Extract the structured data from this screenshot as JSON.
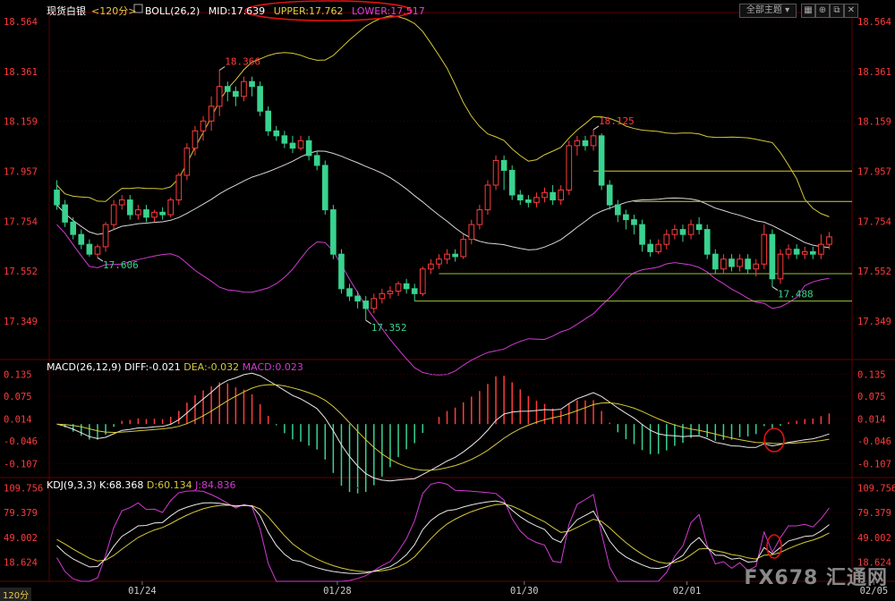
{
  "header": {
    "symbol": "现货白银",
    "period": "<120分>",
    "indicator": "BOLL(26,2)",
    "mid": "MID:17.639",
    "upper": "UPPER:17.762",
    "lower": "LOWER:17.517",
    "menu_label": "全部主题",
    "period_tag": "120分"
  },
  "colors": {
    "background": "#000000",
    "up_candle": "#ff3b3b",
    "down_candle": "#39d38f",
    "boll_mid": "#d8d8d8",
    "boll_upper": "#d6c93a",
    "boll_lower": "#d23bd2",
    "support_line": "#9bc33c",
    "annotation_circle": "#e01010"
  },
  "chart_data": [
    {
      "panel": "price",
      "type": "candlestick",
      "y_ticks": [
        "18.564",
        "18.361",
        "18.159",
        "17.957",
        "17.754",
        "17.552",
        "17.349"
      ],
      "ylim": [
        17.2,
        18.6
      ],
      "x_ticks": [
        "01/24",
        "01/28",
        "01/30",
        "02/01",
        "02/05"
      ],
      "annotations": [
        {
          "text": "18.366",
          "value": 18.366,
          "color": "#ff3b3b"
        },
        {
          "text": "17.606",
          "value": 17.606,
          "color": "#39d38f"
        },
        {
          "text": "17.352",
          "value": 17.352,
          "color": "#39d38f"
        },
        {
          "text": "18.125",
          "value": 18.125,
          "color": "#ff3b3b"
        },
        {
          "text": "17.488",
          "value": 17.488,
          "color": "#39d38f"
        }
      ],
      "horizontal_lines": [
        17.957,
        17.834,
        17.541,
        17.43
      ],
      "candles": [
        [
          17.88,
          17.82,
          17.92,
          17.8
        ],
        [
          17.82,
          17.75,
          17.84,
          17.73
        ],
        [
          17.75,
          17.7,
          17.77,
          17.68
        ],
        [
          17.7,
          17.66,
          17.72,
          17.64
        ],
        [
          17.66,
          17.62,
          17.68,
          17.61
        ],
        [
          17.62,
          17.65,
          17.66,
          17.606
        ],
        [
          17.65,
          17.74,
          17.75,
          17.63
        ],
        [
          17.74,
          17.82,
          17.84,
          17.72
        ],
        [
          17.82,
          17.84,
          17.86,
          17.8
        ],
        [
          17.84,
          17.78,
          17.86,
          17.76
        ],
        [
          17.78,
          17.8,
          17.82,
          17.76
        ],
        [
          17.8,
          17.77,
          17.82,
          17.75
        ],
        [
          17.77,
          17.79,
          17.8,
          17.75
        ],
        [
          17.79,
          17.78,
          17.81,
          17.76
        ],
        [
          17.78,
          17.84,
          17.85,
          17.77
        ],
        [
          17.84,
          17.94,
          17.95,
          17.82
        ],
        [
          17.94,
          18.05,
          18.07,
          17.92
        ],
        [
          18.05,
          18.12,
          18.14,
          18.02
        ],
        [
          18.12,
          18.16,
          18.18,
          18.08
        ],
        [
          18.16,
          18.22,
          18.26,
          18.12
        ],
        [
          18.22,
          18.3,
          18.366,
          18.18
        ],
        [
          18.3,
          18.28,
          18.32,
          18.24
        ],
        [
          18.28,
          18.26,
          18.3,
          18.22
        ],
        [
          18.26,
          18.32,
          18.34,
          18.24
        ],
        [
          18.32,
          18.3,
          18.34,
          18.26
        ],
        [
          18.3,
          18.2,
          18.32,
          18.18
        ],
        [
          18.2,
          18.12,
          18.22,
          18.1
        ],
        [
          18.12,
          18.1,
          18.14,
          18.08
        ],
        [
          18.1,
          18.07,
          18.12,
          18.05
        ],
        [
          18.07,
          18.05,
          18.1,
          18.03
        ],
        [
          18.05,
          18.08,
          18.1,
          18.04
        ],
        [
          18.08,
          18.02,
          18.1,
          18.0
        ],
        [
          18.02,
          17.98,
          18.04,
          17.96
        ],
        [
          17.98,
          17.8,
          18.0,
          17.78
        ],
        [
          17.8,
          17.62,
          17.82,
          17.6
        ],
        [
          17.62,
          17.48,
          17.64,
          17.46
        ],
        [
          17.48,
          17.45,
          17.5,
          17.43
        ],
        [
          17.45,
          17.43,
          17.47,
          17.4
        ],
        [
          17.43,
          17.4,
          17.45,
          17.352
        ],
        [
          17.4,
          17.44,
          17.46,
          17.38
        ],
        [
          17.44,
          17.46,
          17.48,
          17.42
        ],
        [
          17.46,
          17.47,
          17.49,
          17.44
        ],
        [
          17.47,
          17.5,
          17.51,
          17.45
        ],
        [
          17.5,
          17.48,
          17.52,
          17.46
        ],
        [
          17.48,
          17.46,
          17.5,
          17.43
        ],
        [
          17.46,
          17.56,
          17.57,
          17.45
        ],
        [
          17.56,
          17.58,
          17.6,
          17.54
        ],
        [
          17.58,
          17.6,
          17.62,
          17.56
        ],
        [
          17.6,
          17.62,
          17.64,
          17.58
        ],
        [
          17.62,
          17.61,
          17.64,
          17.59
        ],
        [
          17.61,
          17.68,
          17.7,
          17.6
        ],
        [
          17.68,
          17.74,
          17.76,
          17.66
        ],
        [
          17.74,
          17.8,
          17.82,
          17.72
        ],
        [
          17.8,
          17.9,
          17.92,
          17.78
        ],
        [
          17.9,
          18.0,
          18.02,
          17.88
        ],
        [
          18.0,
          17.96,
          18.02,
          17.88
        ],
        [
          17.96,
          17.86,
          17.98,
          17.84
        ],
        [
          17.86,
          17.84,
          17.88,
          17.82
        ],
        [
          17.84,
          17.83,
          17.86,
          17.81
        ],
        [
          17.83,
          17.85,
          17.87,
          17.81
        ],
        [
          17.85,
          17.87,
          17.89,
          17.83
        ],
        [
          17.87,
          17.84,
          17.9,
          17.82
        ],
        [
          17.84,
          17.88,
          17.9,
          17.82
        ],
        [
          17.88,
          18.06,
          18.08,
          17.86
        ],
        [
          18.06,
          18.08,
          18.1,
          18.02
        ],
        [
          18.08,
          18.06,
          18.1,
          18.04
        ],
        [
          18.06,
          18.1,
          18.125,
          18.04
        ],
        [
          18.1,
          17.9,
          18.11,
          17.88
        ],
        [
          17.9,
          17.82,
          17.92,
          17.8
        ],
        [
          17.82,
          17.78,
          17.84,
          17.75
        ],
        [
          17.78,
          17.76,
          17.8,
          17.72
        ],
        [
          17.76,
          17.74,
          17.78,
          17.7
        ],
        [
          17.74,
          17.66,
          17.76,
          17.63
        ],
        [
          17.66,
          17.63,
          17.68,
          17.61
        ],
        [
          17.63,
          17.66,
          17.68,
          17.62
        ],
        [
          17.66,
          17.7,
          17.72,
          17.64
        ],
        [
          17.7,
          17.72,
          17.74,
          17.68
        ],
        [
          17.72,
          17.7,
          17.74,
          17.67
        ],
        [
          17.7,
          17.74,
          17.76,
          17.68
        ],
        [
          17.74,
          17.72,
          17.77,
          17.7
        ],
        [
          17.72,
          17.62,
          17.74,
          17.6
        ],
        [
          17.62,
          17.56,
          17.64,
          17.54
        ],
        [
          17.56,
          17.6,
          17.62,
          17.54
        ],
        [
          17.6,
          17.57,
          17.62,
          17.55
        ],
        [
          17.57,
          17.6,
          17.62,
          17.55
        ],
        [
          17.6,
          17.56,
          17.62,
          17.54
        ],
        [
          17.56,
          17.58,
          17.6,
          17.53
        ],
        [
          17.58,
          17.7,
          17.74,
          17.56
        ],
        [
          17.7,
          17.52,
          17.72,
          17.488
        ],
        [
          17.52,
          17.62,
          17.64,
          17.5
        ],
        [
          17.62,
          17.64,
          17.66,
          17.6
        ],
        [
          17.64,
          17.62,
          17.66,
          17.6
        ],
        [
          17.62,
          17.63,
          17.65,
          17.6
        ],
        [
          17.63,
          17.62,
          17.65,
          17.6
        ],
        [
          17.62,
          17.66,
          17.7,
          17.6
        ],
        [
          17.66,
          17.69,
          17.71,
          17.64
        ]
      ]
    },
    {
      "panel": "macd",
      "type": "bar+line",
      "label": "MACD(26,12,9)",
      "diff_label": "DIFF:-0.021",
      "dea_label": "DEA:-0.032",
      "macd_label": "MACD:0.023",
      "y_ticks": [
        "0.135",
        "0.075",
        "0.014",
        "-0.046",
        "-0.107"
      ],
      "ylim": [
        -0.14,
        0.17
      ]
    },
    {
      "panel": "kdj",
      "type": "line",
      "label": "KDJ(9,3,3)",
      "k_label": "K:68.368",
      "d_label": "D:60.134",
      "j_label": "J:84.836",
      "y_ticks": [
        "109.756",
        "79.379",
        "49.002",
        "18.624"
      ],
      "ylim": [
        -5,
        120
      ]
    }
  ]
}
